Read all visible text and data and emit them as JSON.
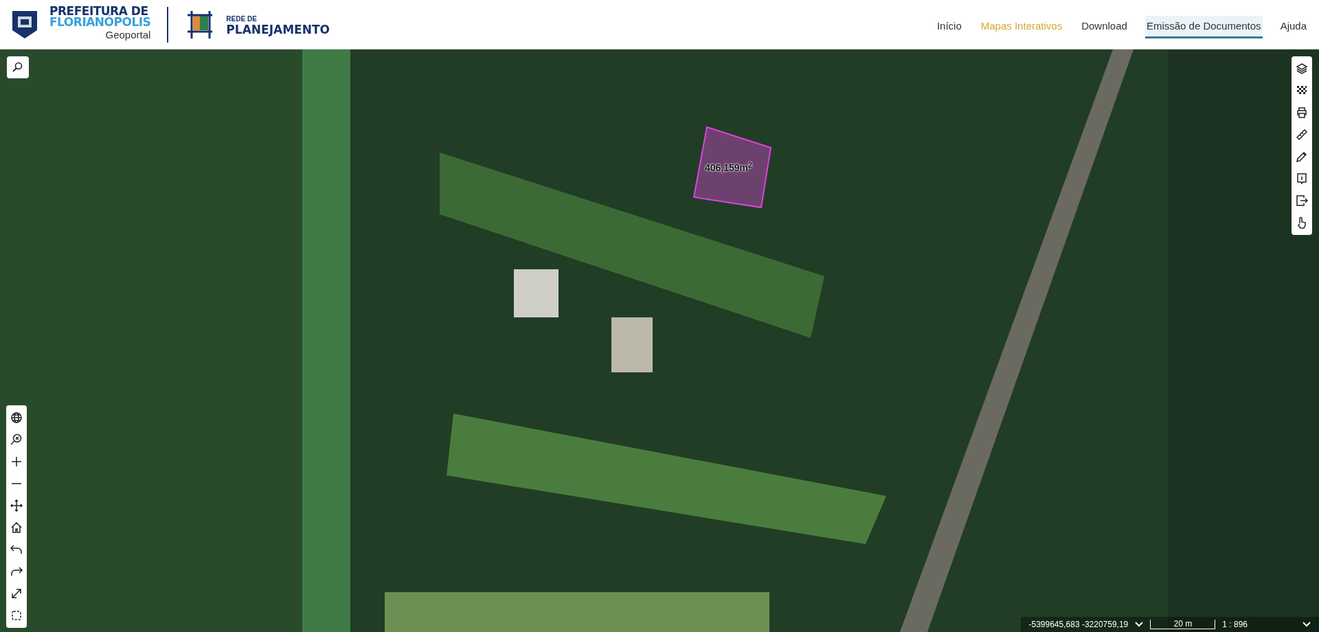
{
  "header": {
    "logo_title_line1": "PREFEITURA DE",
    "logo_title_line2": "FLORIANÓPOLIS",
    "logo_subtitle": "Geoportal",
    "partner_small": "REDE DE",
    "partner_large": "PLANEJAMENTO"
  },
  "nav": [
    {
      "label": "Início",
      "current": false,
      "selected": false
    },
    {
      "label": "Mapas Interativos",
      "current": true,
      "selected": false
    },
    {
      "label": "Download",
      "current": false,
      "selected": false
    },
    {
      "label": "Emissão de Documentos",
      "current": false,
      "selected": true
    },
    {
      "label": "Ajuda",
      "current": false,
      "selected": false
    }
  ],
  "map": {
    "measurement": "406,159m$^{2}$"
  },
  "left_tools": [
    {
      "kind": "globe"
    },
    {
      "kind": "zoom-extent"
    },
    {
      "kind": "plus"
    },
    {
      "kind": "minus"
    },
    {
      "kind": "pan"
    },
    {
      "kind": "home"
    },
    {
      "kind": "undo"
    },
    {
      "kind": "redo"
    },
    {
      "kind": "expand"
    },
    {
      "kind": "select"
    }
  ],
  "right_tools": [
    {
      "kind": "layers"
    },
    {
      "kind": "grid"
    },
    {
      "kind": "print"
    },
    {
      "kind": "ruler"
    },
    {
      "kind": "pencil"
    },
    {
      "kind": "info"
    },
    {
      "kind": "export"
    },
    {
      "kind": "hand"
    }
  ],
  "status_bar": {
    "coordinates": "-5399645,683 -3220759,19",
    "scale_bar": "20 m",
    "scale": "1 : 896"
  }
}
